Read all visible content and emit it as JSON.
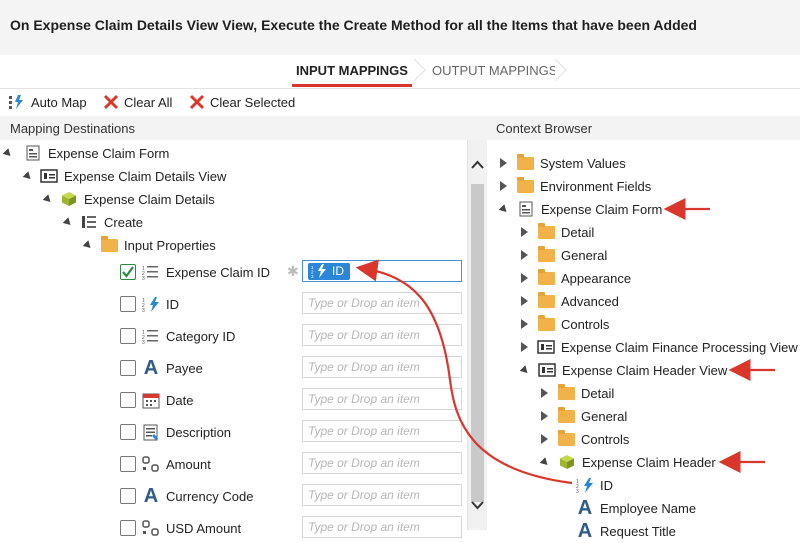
{
  "header": {
    "title": "On Expense Claim Details View View, Execute the Create Method for all the Items that have been Added"
  },
  "tabs": {
    "input": "INPUT MAPPINGS",
    "output": "OUTPUT MAPPINGS"
  },
  "toolbar": {
    "auto_map": "Auto Map",
    "clear_all": "Clear All",
    "clear_selected": "Clear Selected"
  },
  "left": {
    "title": "Mapping Destinations",
    "tree": {
      "form": "Expense Claim Form",
      "view": "Expense Claim Details View",
      "smo": "Expense Claim Details",
      "method": "Create",
      "props": "Input Properties"
    },
    "properties": [
      {
        "label": "Expense Claim ID",
        "checked": true,
        "icon": "number-list-icon"
      },
      {
        "label": "ID",
        "checked": false,
        "icon": "autonumber-icon"
      },
      {
        "label": "Category ID",
        "checked": false,
        "icon": "number-list-icon"
      },
      {
        "label": "Payee",
        "checked": false,
        "icon": "text-a-icon"
      },
      {
        "label": "Date",
        "checked": false,
        "icon": "calendar-icon"
      },
      {
        "label": "Description",
        "checked": false,
        "icon": "memo-icon"
      },
      {
        "label": "Amount",
        "checked": false,
        "icon": "decimal-icon"
      },
      {
        "label": "Currency Code",
        "checked": false,
        "icon": "text-a-icon"
      },
      {
        "label": "USD Amount",
        "checked": false,
        "icon": "decimal-icon"
      }
    ],
    "mapped_value": "ID",
    "placeholder": "Type or Drop an item"
  },
  "right": {
    "title": "Context Browser",
    "items": [
      {
        "label": "System Values"
      },
      {
        "label": "Environment Fields"
      },
      {
        "label": "Expense Claim Form"
      },
      {
        "label": "Detail"
      },
      {
        "label": "General"
      },
      {
        "label": "Appearance"
      },
      {
        "label": "Advanced"
      },
      {
        "label": "Controls"
      },
      {
        "label": "Expense Claim Finance Processing View"
      },
      {
        "label": "Expense Claim Header View"
      },
      {
        "label": "Detail"
      },
      {
        "label": "General"
      },
      {
        "label": "Controls"
      },
      {
        "label": "Expense Claim Header"
      },
      {
        "label": "ID"
      },
      {
        "label": "Employee Name"
      },
      {
        "label": "Request Title"
      }
    ]
  },
  "colors": {
    "accent_red": "#d9362c",
    "chip_blue": "#2b86d8",
    "arrow_red": "#d9362c"
  }
}
